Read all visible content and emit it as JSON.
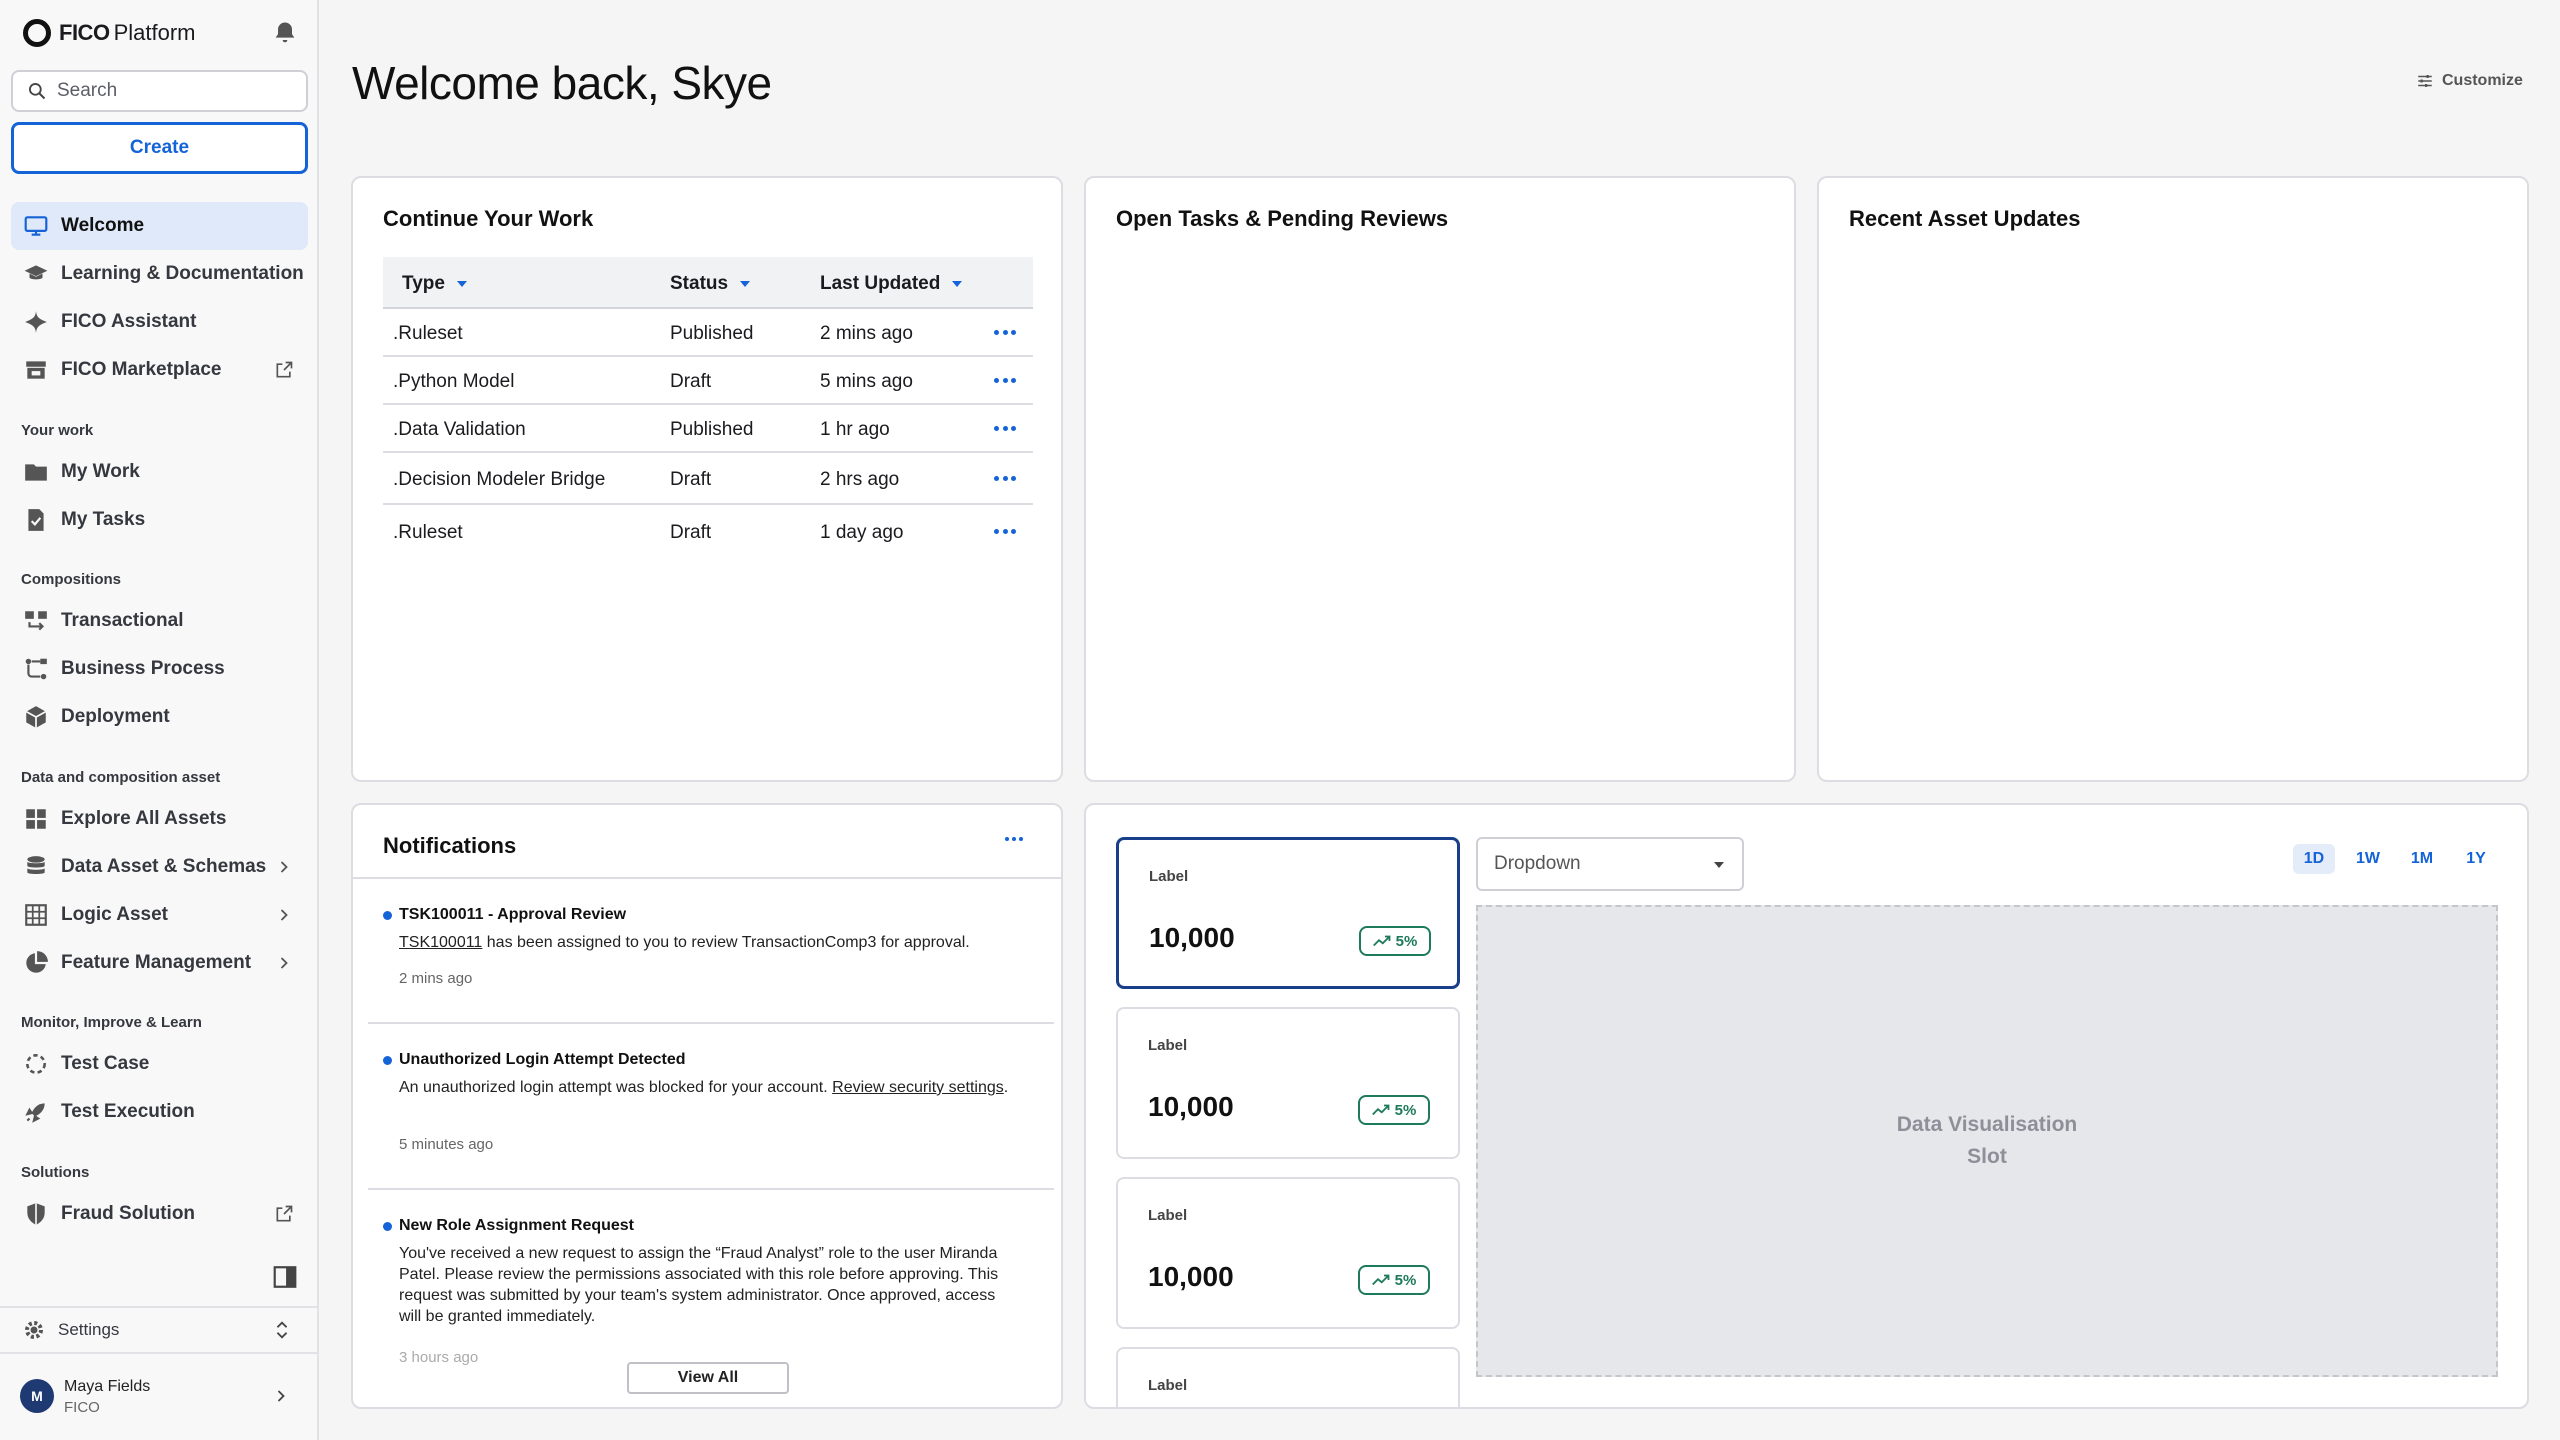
{
  "brand": {
    "fico": "FICO",
    "platform": "Platform"
  },
  "sidebar": {
    "search_placeholder": "Search",
    "create_label": "Create",
    "primary": [
      {
        "label": "Welcome",
        "icon": "monitor-icon"
      },
      {
        "label": "Learning & Documentation",
        "icon": "graduation-cap-icon"
      },
      {
        "label": "FICO Assistant",
        "icon": "sparkle-icon"
      },
      {
        "label": "FICO Marketplace",
        "icon": "store-icon"
      }
    ],
    "sections": {
      "your_work": "Your work",
      "compositions": "Compositions",
      "data_assets": "Data and composition asset",
      "monitor": "Monitor, Improve & Learn",
      "solutions": "Solutions"
    },
    "your_work_items": [
      "My Work",
      "My Tasks"
    ],
    "composition_items": [
      "Transactional",
      "Business Process",
      "Deployment"
    ],
    "asset_items": [
      "Explore All Assets",
      "Data Asset & Schemas",
      "Logic Asset",
      "Feature Management"
    ],
    "monitor_items": [
      "Test Case",
      "Test Execution"
    ],
    "solution_items": [
      "Fraud Solution"
    ],
    "settings_label": "Settings",
    "user": {
      "initial": "M",
      "name": "Maya Fields",
      "org": "FICO"
    }
  },
  "header": {
    "title": "Welcome back, Skye",
    "customize_label": "Customize"
  },
  "continue_work": {
    "title": "Continue Your Work",
    "columns": [
      "Type",
      "Status",
      "Last Updated"
    ],
    "rows": [
      {
        "type": ".Ruleset",
        "status": "Published",
        "updated": "2 mins ago"
      },
      {
        "type": ".Python Model",
        "status": "Draft",
        "updated": "5 mins ago"
      },
      {
        "type": ".Data Validation",
        "status": "Published",
        "updated": "1 hr ago"
      },
      {
        "type": ".Decision Modeler Bridge",
        "status": "Draft",
        "updated": "2 hrs ago"
      },
      {
        "type": ".Ruleset",
        "status": "Draft",
        "updated": "1 day ago"
      }
    ]
  },
  "open_tasks": {
    "title": "Open Tasks & Pending Reviews"
  },
  "recent_assets": {
    "title": "Recent Asset Updates"
  },
  "notifications": {
    "title": "Notifications",
    "items": [
      {
        "title": "TSK100011 - Approval Review",
        "link": "TSK100011",
        "body": " has been assigned to you to review TransactionComp3 for approval.",
        "time": "2 mins ago"
      },
      {
        "title": "Unauthorized Login Attempt Detected",
        "body": "An unauthorized login attempt was blocked for your account. ",
        "link": "Review security settings",
        "tail": ".",
        "time": "5 minutes ago"
      },
      {
        "title": "New Role Assignment Request",
        "body": "You've received a new request to assign the “Fraud Analyst” role to the user Miranda Patel. Please review the permissions associated with this role before approving. This request was submitted by your team's system administrator. Once approved, access will be granted immediately.",
        "time": "3 hours ago"
      }
    ],
    "view_all": "View All"
  },
  "metrics": {
    "cards": [
      {
        "label": "Label",
        "value": "10,000",
        "change": "5%"
      },
      {
        "label": "Label",
        "value": "10,000",
        "change": "5%"
      },
      {
        "label": "Label",
        "value": "10,000",
        "change": "5%"
      },
      {
        "label": "Label"
      }
    ],
    "dropdown_value": "Dropdown",
    "ranges": [
      "1D",
      "1W",
      "1M",
      "1Y"
    ],
    "active_range": "1D",
    "viz_line1": "Data Visualisation",
    "viz_line2": "Slot"
  },
  "colors": {
    "accent": "#1463d8",
    "positive": "#1d7a5a",
    "selected_border": "#1a3f8a"
  }
}
